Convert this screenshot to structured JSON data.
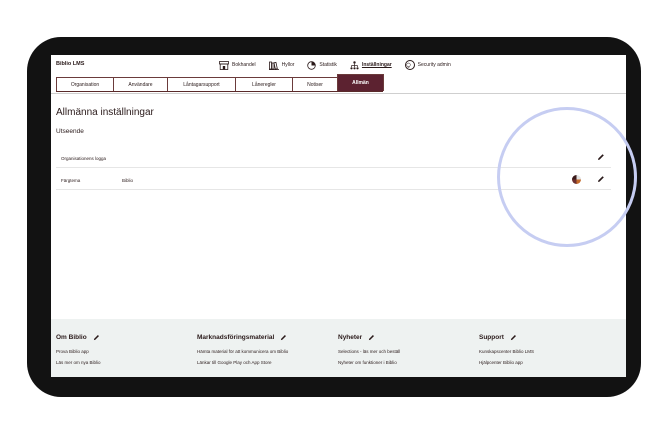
{
  "app": {
    "brand": "Biblio LMS"
  },
  "topnav": [
    {
      "label": "Bokhandel",
      "icon": "store-icon",
      "active": false
    },
    {
      "label": "Hyllor",
      "icon": "bookshelf-icon",
      "active": false
    },
    {
      "label": "Statistik",
      "icon": "pie-chart-icon",
      "active": false
    },
    {
      "label": "Inställningar",
      "icon": "org-chart-icon",
      "active": true
    },
    {
      "label": "Security admin",
      "icon": "lightbulb-icon",
      "active": false
    }
  ],
  "tabs": [
    {
      "label": "Organisation",
      "active": false
    },
    {
      "label": "Användare",
      "active": false
    },
    {
      "label": "Låntagarsupport",
      "active": false
    },
    {
      "label": "Låneregler",
      "active": false
    },
    {
      "label": "Notiser",
      "active": false
    },
    {
      "label": "Allmän",
      "active": true
    }
  ],
  "page": {
    "title": "Allmänna inställningar",
    "section": "Utseende",
    "rows": [
      {
        "label": "Organisationens logga",
        "value": "",
        "has_theme": false
      },
      {
        "label": "Färgtema",
        "value": "Biblio",
        "has_theme": true
      }
    ]
  },
  "footer": {
    "columns": [
      {
        "heading": "Om Biblio",
        "links": [
          "Prova Biblio app",
          "Läs mer om nya Biblio"
        ]
      },
      {
        "heading": "Marknadsföringsmaterial",
        "links": [
          "Hämta material för att kommunicera om Biblio",
          "Länkar till Google Play och App Store"
        ]
      },
      {
        "heading": "Nyheter",
        "links": [
          "Selections - läs mer och beställ",
          "Nyheter om funktioner i Biblio"
        ]
      },
      {
        "heading": "Support",
        "links": [
          "Kunskapscenter Biblio LMS",
          "Hjälpcenter Biblio app"
        ]
      }
    ]
  },
  "colors": {
    "accent": "#5c2230",
    "text": "#2a1a1a",
    "footer_bg": "#eef2f1",
    "highlight_ring": "#c6cdf2",
    "device_frame": "#121212"
  }
}
